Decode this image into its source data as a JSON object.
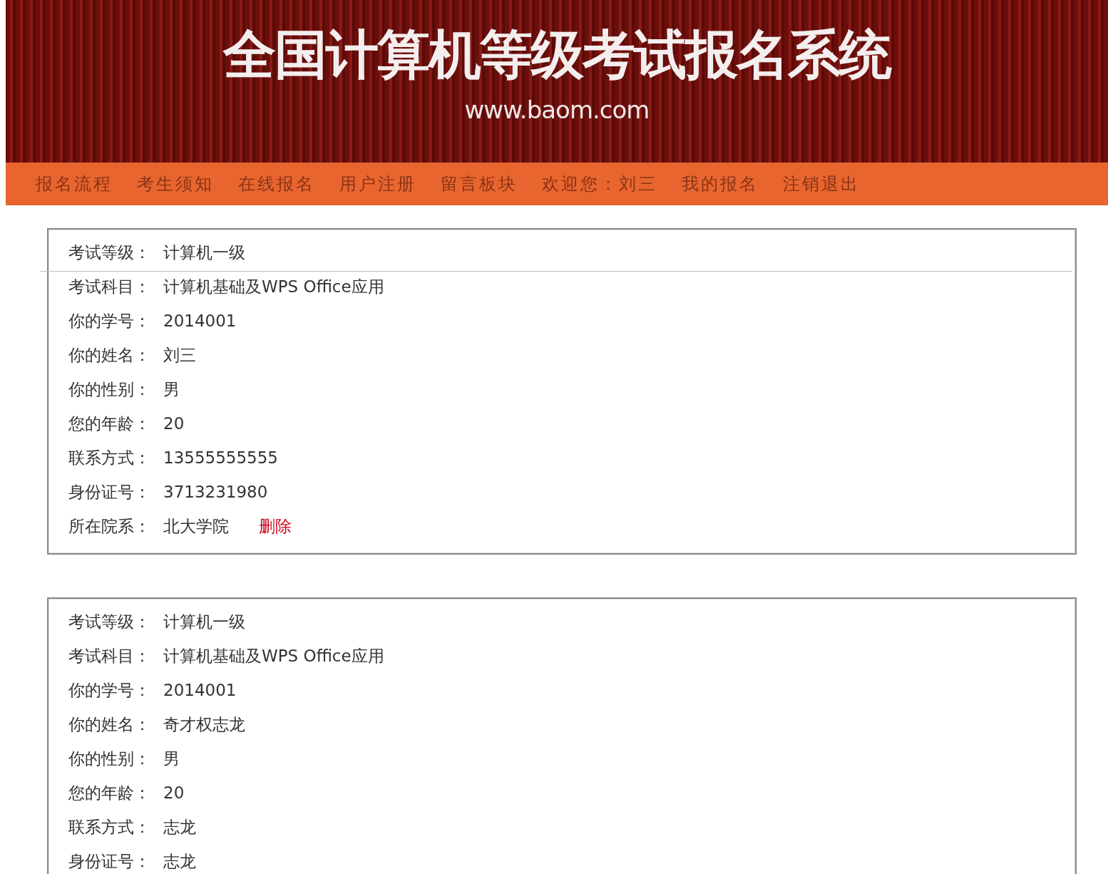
{
  "header": {
    "title": "全国计算机等级考试报名系统",
    "url": "www.baom.com"
  },
  "nav": [
    "报名流程",
    "考生须知",
    "在线报名",
    "用户注册",
    "留言板块",
    "欢迎您：刘三",
    "我的报名",
    "注销退出"
  ],
  "records": [
    {
      "fields": [
        {
          "label": "考试等级：",
          "value": "计算机一级"
        },
        {
          "label": "考试科目：",
          "value": "计算机基础及WPS Office应用"
        },
        {
          "label": "你的学号：",
          "value": "2014001"
        },
        {
          "label": "你的姓名：",
          "value": "刘三"
        },
        {
          "label": "你的性别：",
          "value": "男"
        },
        {
          "label": "您的年龄：",
          "value": "20"
        },
        {
          "label": "联系方式：",
          "value": "13555555555"
        },
        {
          "label": "身份证号：",
          "value": "3713231980"
        },
        {
          "label": "所在院系：",
          "value": "北大学院",
          "action": "删除"
        }
      ]
    },
    {
      "fields": [
        {
          "label": "考试等级：",
          "value": "计算机一级"
        },
        {
          "label": "考试科目：",
          "value": "计算机基础及WPS Office应用"
        },
        {
          "label": "你的学号：",
          "value": "2014001"
        },
        {
          "label": "你的姓名：",
          "value": "奇才权志龙"
        },
        {
          "label": "你的性别：",
          "value": "男"
        },
        {
          "label": "您的年龄：",
          "value": "20"
        },
        {
          "label": "联系方式：",
          "value": "志龙"
        },
        {
          "label": "身份证号：",
          "value": "志龙"
        }
      ]
    }
  ]
}
